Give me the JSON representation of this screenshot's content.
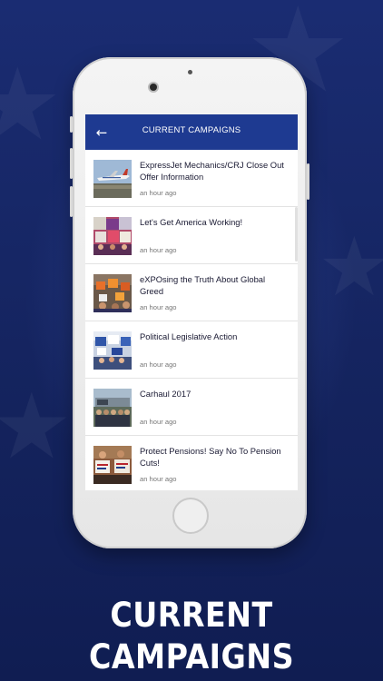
{
  "app_bar": {
    "title": "CURRENT CAMPAIGNS",
    "back_icon": "arrow-left-icon"
  },
  "campaigns": [
    {
      "title": "ExpressJet Mechanics/CRJ Close Out Offer Information",
      "time": "an hour ago",
      "thumb": "airplane"
    },
    {
      "title": "Let's Get America Working!",
      "time": "an hour ago",
      "thumb": "crowd-signs"
    },
    {
      "title": "eXPOsing the Truth About Global Greed",
      "time": "an hour ago",
      "thumb": "protest-orange"
    },
    {
      "title": "Political Legislative Action",
      "time": "an hour ago",
      "thumb": "rally-blue"
    },
    {
      "title": "Carhaul 2017",
      "time": "an hour ago",
      "thumb": "truck-group"
    },
    {
      "title": "Protect Pensions! Say No To Pension Cuts!",
      "time": "an hour ago",
      "thumb": "people-signs"
    }
  ],
  "headline": "CURRENT CAMPAIGNS",
  "colors": {
    "background": "#172766",
    "app_bar": "#1e3a91",
    "phone_body": "#f0f0f0"
  }
}
